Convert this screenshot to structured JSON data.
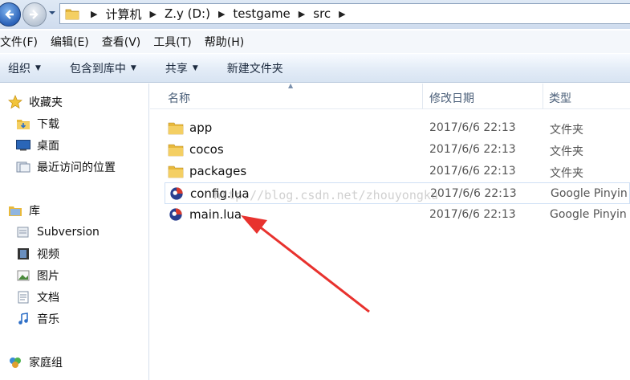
{
  "address": {
    "crumbs": [
      "计算机",
      "Z.y (D:)",
      "testgame",
      "src"
    ]
  },
  "menu": [
    "文件(F)",
    "编辑(E)",
    "查看(V)",
    "工具(T)",
    "帮助(H)"
  ],
  "toolbar": {
    "organize": "组织",
    "include_library": "包含到库中",
    "share": "共享",
    "new_folder": "新建文件夹"
  },
  "nav": {
    "favorites": "收藏夹",
    "downloads": "下载",
    "desktop": "桌面",
    "recent": "最近访问的位置",
    "libraries": "库",
    "subversion": "Subversion",
    "videos": "视频",
    "pictures": "图片",
    "documents": "文档",
    "music": "音乐",
    "homegroup": "家庭组"
  },
  "columns": {
    "name": "名称",
    "modified": "修改日期",
    "type": "类型"
  },
  "files": [
    {
      "name": "app",
      "date": "2017/6/6 22:13",
      "type": "文件夹",
      "kind": "folder"
    },
    {
      "name": "cocos",
      "date": "2017/6/6 22:13",
      "type": "文件夹",
      "kind": "folder"
    },
    {
      "name": "packages",
      "date": "2017/6/6 22:13",
      "type": "文件夹",
      "kind": "folder"
    },
    {
      "name": "config.lua",
      "date": "2017/6/6 22:13",
      "type": "Google Pinyin",
      "kind": "lua-file"
    },
    {
      "name": "main.lua",
      "date": "2017/6/6 22:13",
      "type": "Google Pinyin",
      "kind": "lua-file"
    }
  ],
  "watermark": "http://blog.csdn.net/zhouyongku",
  "colors": {
    "arrow": "#e8322e",
    "toolbar": "#dfe9f5",
    "folder": "#e8b93c"
  }
}
